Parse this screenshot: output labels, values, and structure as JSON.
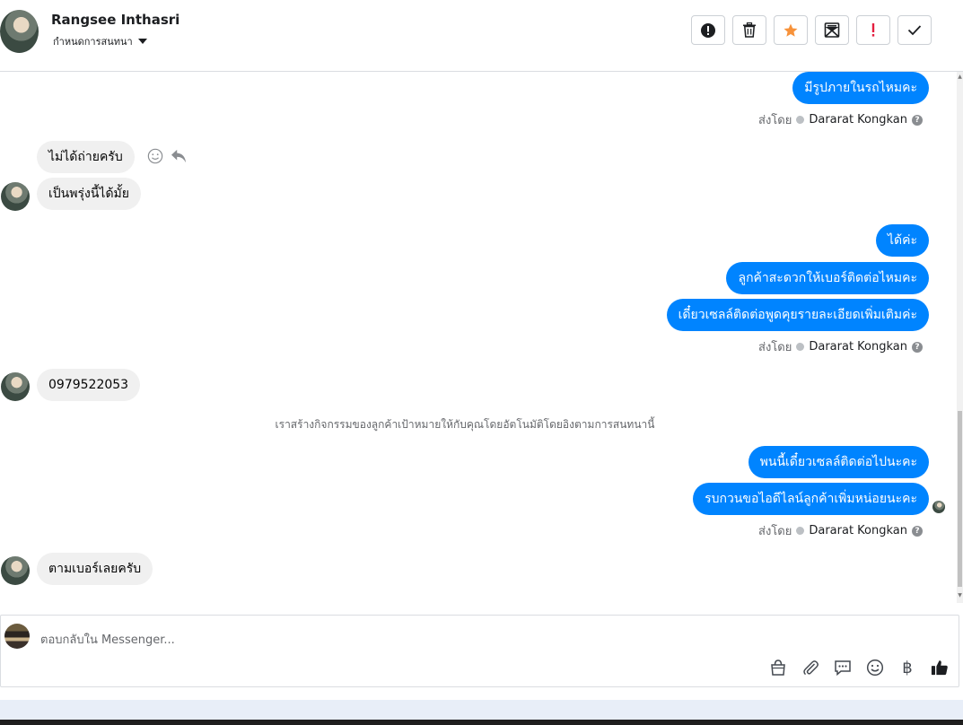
{
  "header": {
    "contact_name": "Rangsee Inthasri",
    "label_select": "กำหนดการสนทนา",
    "toolbar": [
      {
        "icon": "alert-circle-icon"
      },
      {
        "icon": "trash-icon"
      },
      {
        "icon": "star-icon"
      },
      {
        "icon": "mark-unread-icon"
      },
      {
        "icon": "exclamation-icon"
      },
      {
        "icon": "check-icon"
      }
    ]
  },
  "thread": {
    "messages": {
      "m1": "มีรูปภายในรถไหมคะ",
      "m2": "ไม่ได้ถ่ายครับ",
      "m3": "เป็นพรุ่งนี้ได้มั้ย",
      "m4": "ได้ค่ะ",
      "m5": "ลูกค้าสะดวกให้เบอร์ติดต่อไหมคะ",
      "m6": "เดี๋ยวเซลล์ติดต่อพูดคุยรายละเอียดเพิ่มเติมค่ะ",
      "m7": "0979522053",
      "m8": "พนนี้เดี๋ยวเซลล์ติดต่อไปนะคะ",
      "m9": "รบกวนขอไอดีไลน์ลูกค้าเพิ่มหน่อยนะคะ",
      "m10": "ตามเบอร์เลยครับ"
    },
    "sent_by_label": "ส่งโดย",
    "agent_name": "Dararat Kongkan",
    "help_glyph": "?",
    "system_note": "เราสร้างกิจกรรมของลูกค้าเป้าหมายให้กับคุณโดยอัตโนมัติโดยอิงตามการสนทนานี้"
  },
  "composer": {
    "placeholder": "ตอบกลับใน Messenger...",
    "currency_symbol": "฿",
    "icons": [
      "shopping-bag-icon",
      "paperclip-icon",
      "saved-replies-icon",
      "emoji-icon",
      "baht-icon",
      "thumbs-up-icon"
    ]
  },
  "colors": {
    "outgoing_bubble": "#0084ff",
    "incoming_bubble": "#f0f0f0",
    "star": "#f7923a",
    "exclamation": "#e41e3f"
  }
}
